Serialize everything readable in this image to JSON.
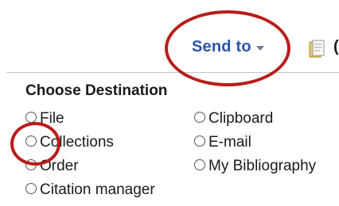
{
  "toolbar": {
    "send_to_label": "Send to",
    "caret_icon": "chevron-down-icon",
    "clipboard_icon": "clipboard-icon",
    "edge_text": "("
  },
  "panel": {
    "heading": "Choose Destination",
    "options": [
      {
        "label": "File"
      },
      {
        "label": "Collections"
      },
      {
        "label": "Order"
      },
      {
        "label": "Citation manager"
      },
      {
        "label": "Clipboard"
      },
      {
        "label": "E-mail"
      },
      {
        "label": "My Bibliography"
      }
    ]
  },
  "annotations": {
    "ring_color": "#b91c1c"
  },
  "colors": {
    "link": "#2a55a8"
  }
}
